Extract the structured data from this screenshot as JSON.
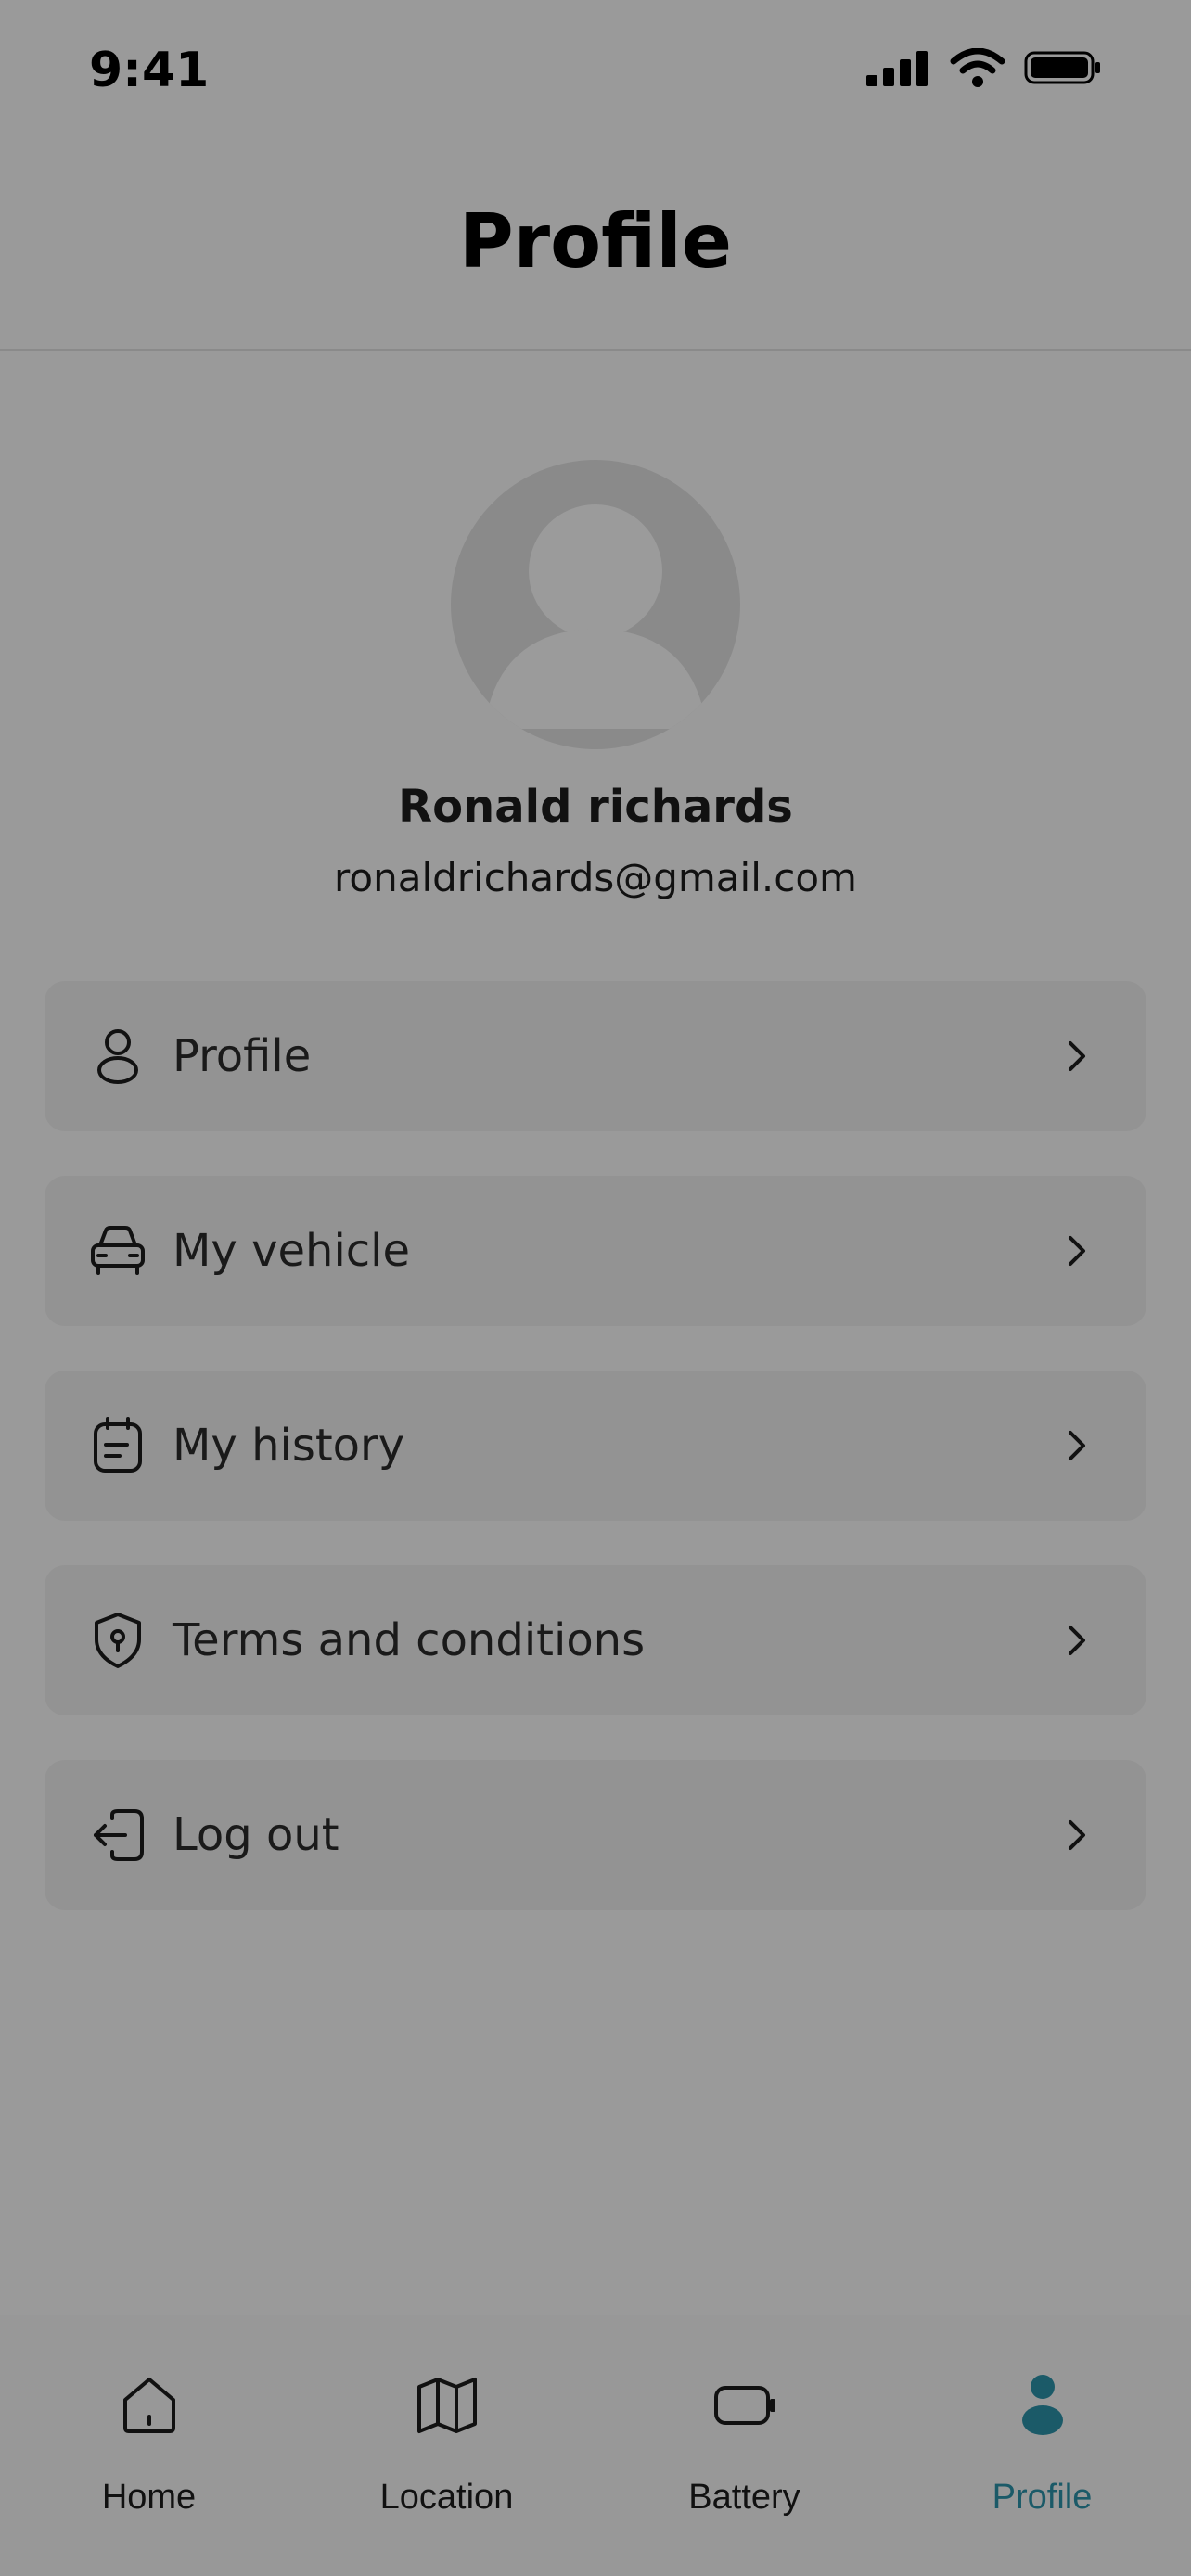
{
  "status_bar": {
    "time": "9:41",
    "icons": [
      "signal-icon",
      "wifi-icon",
      "battery-icon"
    ]
  },
  "header": {
    "title": "Profile"
  },
  "user": {
    "name": "Ronald richards",
    "email": "ronaldrichards@gmail.com"
  },
  "menu": {
    "items": [
      {
        "label": "Profile",
        "icon": "person-icon"
      },
      {
        "label": "My vehicle",
        "icon": "car-icon"
      },
      {
        "label": "My history",
        "icon": "calendar-note-icon"
      },
      {
        "label": "Terms and conditions",
        "icon": "shield-icon"
      },
      {
        "label": "Log out",
        "icon": "logout-icon"
      }
    ]
  },
  "tab_bar": {
    "tabs": [
      {
        "label": "Home",
        "icon": "home-icon"
      },
      {
        "label": "Location",
        "icon": "map-icon"
      },
      {
        "label": "Battery",
        "icon": "battery-icon"
      },
      {
        "label": "Profile",
        "icon": "person-filled-icon",
        "active": true
      }
    ],
    "active_color": "#1b5a68"
  }
}
